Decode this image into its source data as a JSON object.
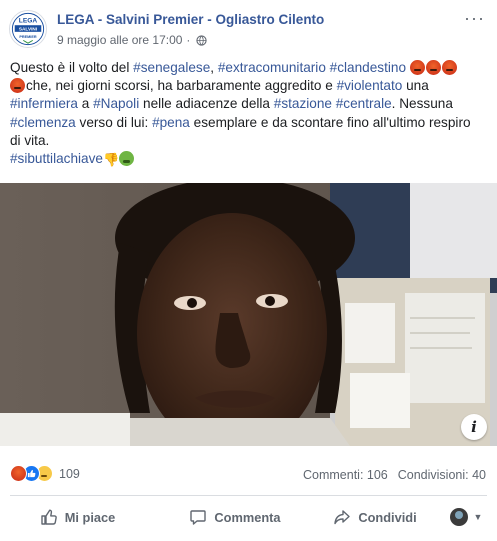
{
  "post": {
    "page_name": "LEGA - Salvini Premier - Ogliastro Cilento",
    "timestamp": "9 maggio alle ore 17:00",
    "separator": "·",
    "audience_icon": "globe-icon",
    "more_icon": "···",
    "avatar_logo": {
      "top": "LEGA",
      "middle": "SALVINI",
      "bottom": "PREMIER"
    }
  },
  "text": {
    "l1_a": "Questo è il volto del ",
    "l1_t1": "#senegalese",
    "l1_b": ", ",
    "l1_t2": "#extracomunitario",
    "l1_c": " ",
    "l1_t3": "#clandestino",
    "l2_a": "che, nei giorni scorsi, ha barbaramente aggredito e ",
    "l2_t1": "#violentato",
    "l2_b": " una",
    "l3_t1": "#infermiera",
    "l3_a": " a ",
    "l3_t2": "#Napoli",
    "l3_b": " nelle adiacenze della ",
    "l3_t3": "#stazione",
    "l3_c": " ",
    "l3_t4": "#centrale",
    "l3_d": ". Nessuna",
    "l4_t1": "#clemenza",
    "l4_a": " verso di lui: ",
    "l4_t2": "#pena",
    "l4_b": " esemplare e da scontare fino all'ultimo respiro",
    "l5_a": "di vita.",
    "l6_t1": "#sibuttilachiave",
    "thumb_glyph": "👎"
  },
  "photo": {
    "info_label": "i"
  },
  "reactions": {
    "count": "109",
    "icons": [
      "angry-reaction-icon",
      "like-reaction-icon",
      "sad-reaction-icon"
    ]
  },
  "stats": {
    "comments": "Commenti: 106",
    "shares": "Condivisioni: 40"
  },
  "actions": {
    "like": "Mi piace",
    "comment": "Commenta",
    "share": "Condividi"
  },
  "colors": {
    "link": "#385898",
    "text": "#1c1e21",
    "muted": "#606770",
    "divider": "#dadde1"
  }
}
